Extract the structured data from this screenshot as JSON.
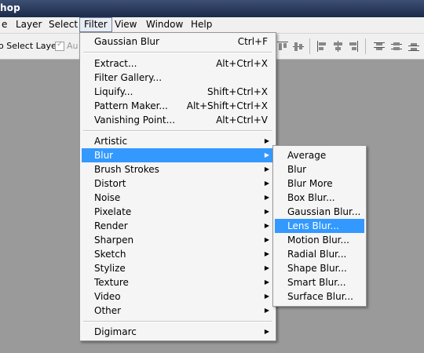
{
  "window": {
    "title_fragment": "hop"
  },
  "menubar": {
    "items": [
      "e",
      "Layer",
      "Select",
      "Filter",
      "View",
      "Window",
      "Help"
    ],
    "active": "Filter"
  },
  "options": {
    "select_layer": "o Select Layer",
    "auto_fragment": "Au"
  },
  "filter_menu": {
    "last_filter": {
      "label": "Gaussian Blur",
      "shortcut": "Ctrl+F"
    },
    "special": [
      {
        "label": "Extract...",
        "shortcut": "Alt+Ctrl+X"
      },
      {
        "label": "Filter Gallery...",
        "shortcut": ""
      },
      {
        "label": "Liquify...",
        "shortcut": "Shift+Ctrl+X"
      },
      {
        "label": "Pattern Maker...",
        "shortcut": "Alt+Shift+Ctrl+X"
      },
      {
        "label": "Vanishing Point...",
        "shortcut": "Alt+Ctrl+V"
      }
    ],
    "groups": [
      "Artistic",
      "Blur",
      "Brush Strokes",
      "Distort",
      "Noise",
      "Pixelate",
      "Render",
      "Sharpen",
      "Sketch",
      "Stylize",
      "Texture",
      "Video",
      "Other"
    ],
    "highlighted_group": "Blur",
    "plugins": [
      "Digimarc"
    ]
  },
  "blur_submenu": {
    "items": [
      "Average",
      "Blur",
      "Blur More",
      "Box Blur...",
      "Gaussian Blur...",
      "Lens Blur...",
      "Motion Blur...",
      "Radial Blur...",
      "Shape Blur...",
      "Smart Blur...",
      "Surface Blur..."
    ],
    "highlighted": "Lens Blur..."
  },
  "colors": {
    "highlight": "#3399ff",
    "menu_bg": "#f5f5f5",
    "workspace": "#9a9a9a"
  }
}
